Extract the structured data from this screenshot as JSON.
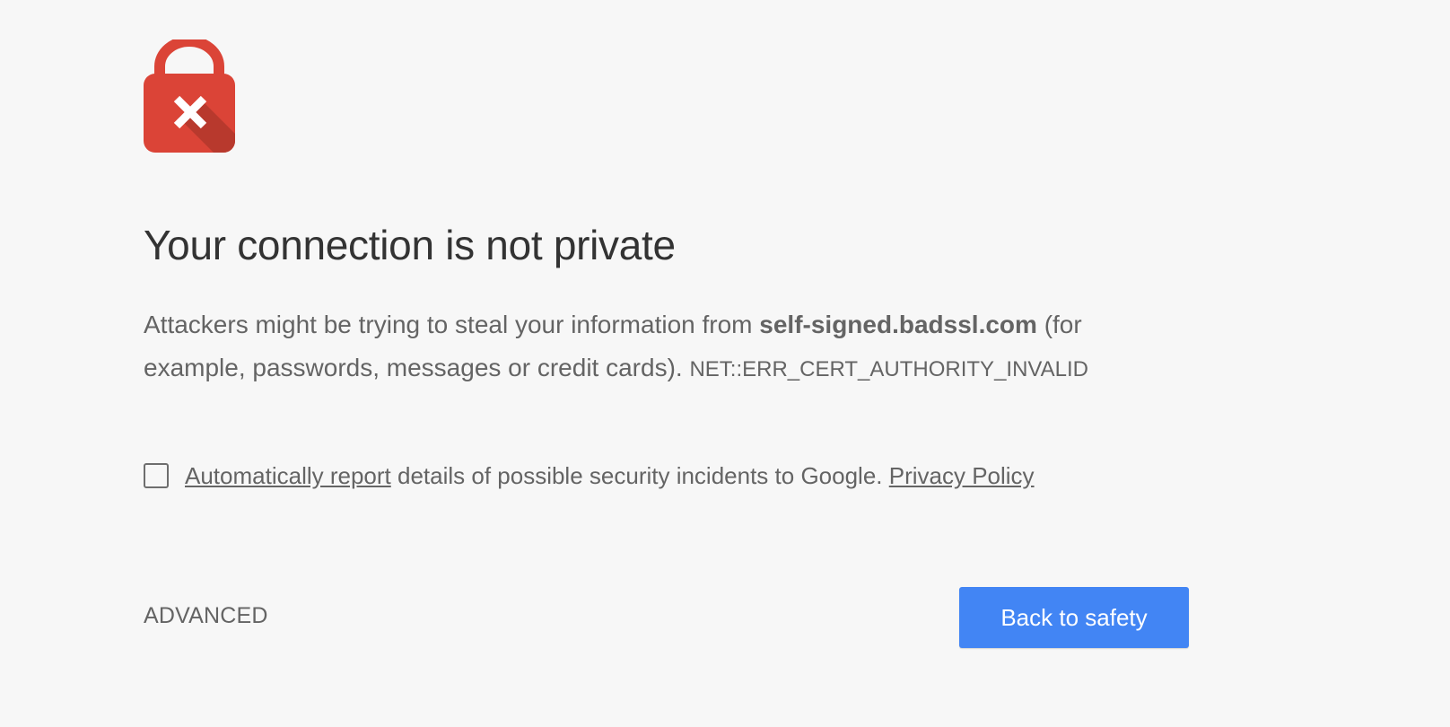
{
  "interstitial": {
    "icon": "lock-error-icon",
    "heading": "Your connection is not private",
    "message_before": "Attackers might be trying to steal your information from ",
    "host": "self-signed.badssl.com",
    "message_after": " (for example, passwords, messages or credit cards). ",
    "error_code": "NET::ERR_CERT_AUTHORITY_INVALID"
  },
  "report": {
    "checked": false,
    "link_label": "Automatically report",
    "text": " details of possible security incidents to Google. ",
    "privacy_link": "Privacy Policy"
  },
  "buttons": {
    "advanced": "ADVANCED",
    "back": "Back to safety"
  },
  "colors": {
    "background": "#f7f7f7",
    "lock_red": "#db4437",
    "primary_blue": "#4285f4"
  }
}
